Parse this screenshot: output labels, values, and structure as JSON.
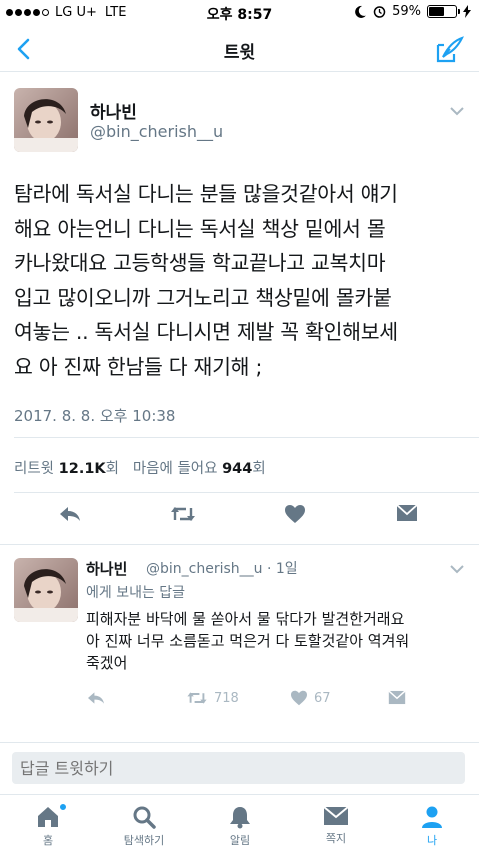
{
  "status_bar": {
    "carrier": "LG U+",
    "network": "LTE",
    "time": "오후 8:57",
    "battery": "59%",
    "battery_level": 0.59
  },
  "nav": {
    "title": "트윗"
  },
  "tweet": {
    "author_name": "하나빈",
    "author_handle": "@bin_cherish__u",
    "text_lines": [
      "탐라에 독서실 다니는 분들 많을것같아서 얘기",
      "해요 아는언니 다니는 독서실 책상 밑에서 몰",
      "카나왔대요 고등학생들 학교끝나고 교복치마",
      "입고 많이오니까 그거노리고 책상밑에 몰카붙",
      "여놓는 .. 독서실 다니시면 제발 꼭 확인해보세",
      "요 아 진짜 한남들 다 재기해 ;"
    ],
    "date": "2017. 8. 8. 오후 10:38",
    "retweet_label": "리트윗",
    "retweet_count": "12.1K",
    "retweet_unit": "회",
    "like_label": "마음에 들어요",
    "like_count": "944",
    "like_unit": "회"
  },
  "reply": {
    "author_name": "하나빈",
    "author_handle": "@bin_cherish__u · 1일",
    "reply_to": "에게 보내는 답글",
    "text_lines": [
      "피해자분 바닥에 물 쏟아서 물 닦다가 발견한거래요",
      "아 진짜 너무 소름돋고 먹은거 다 토할것같아 역겨워",
      "죽겠어"
    ],
    "retweet_count": "718",
    "like_count": "67"
  },
  "input": {
    "placeholder": "답글 트윗하기"
  },
  "tabs": [
    {
      "label": "홈",
      "icon": "home-icon"
    },
    {
      "label": "탐색하기",
      "icon": "search-icon"
    },
    {
      "label": "알림",
      "icon": "bell-icon"
    },
    {
      "label": "쪽지",
      "icon": "envelope-icon"
    },
    {
      "label": "나",
      "icon": "person-icon"
    }
  ],
  "colors": {
    "accent": "#1da1f2",
    "secondary_text": "#657786",
    "primary_text": "#14171a",
    "divider": "#e1e8ed"
  }
}
